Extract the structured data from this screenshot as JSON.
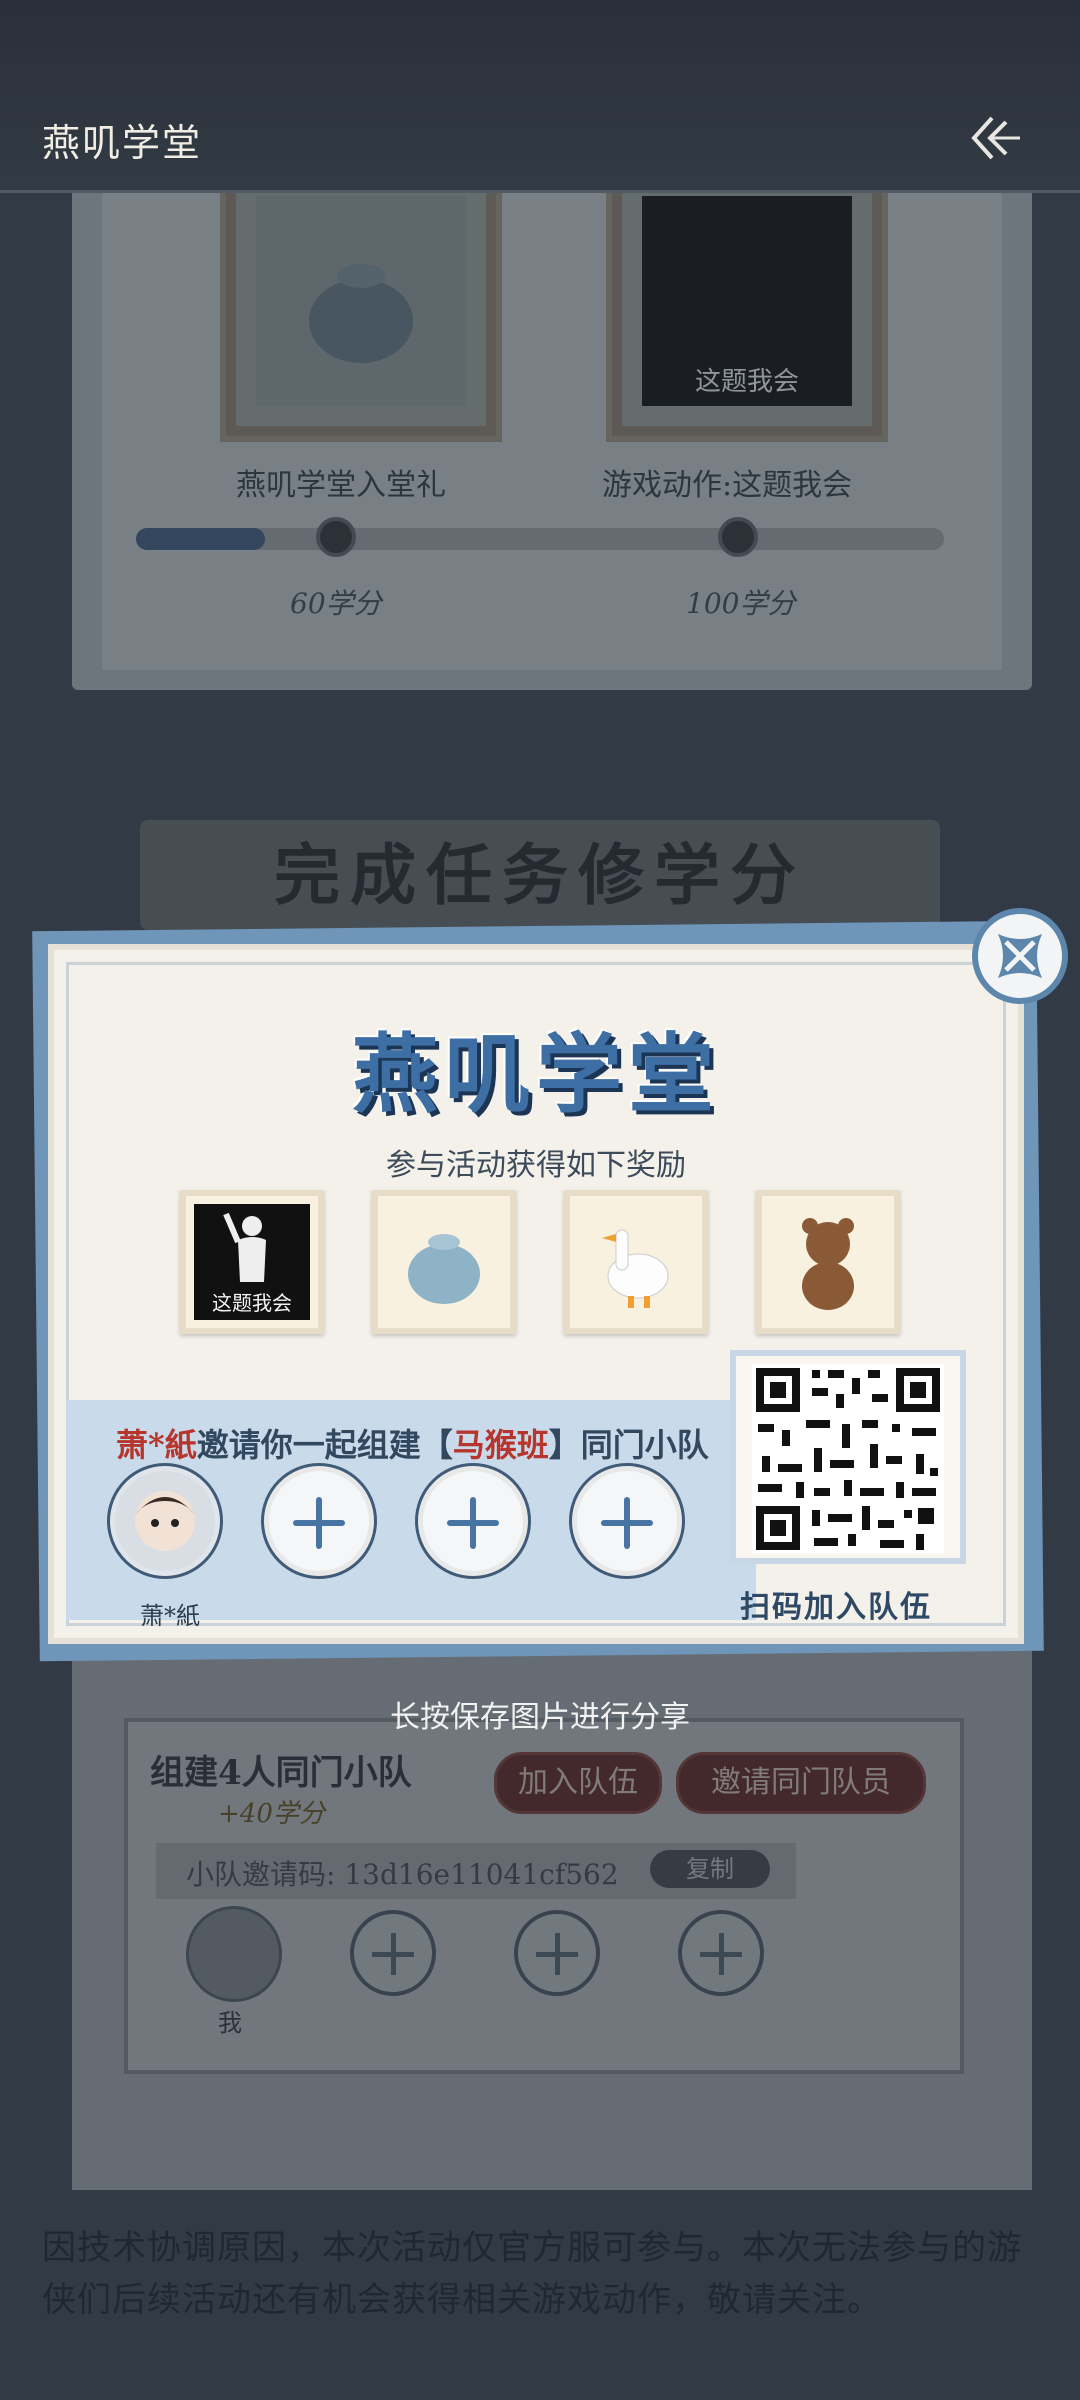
{
  "header": {
    "title": "燕叽学堂"
  },
  "rewards_track": {
    "items": [
      {
        "name": "燕叽学堂入堂礼"
      },
      {
        "name": "游戏动作:这题我会",
        "image_caption": "这题我会"
      }
    ],
    "milestones": [
      "60学分",
      "100学分"
    ],
    "progress_fraction": 0.16
  },
  "section": {
    "banner": "完成任务修学分"
  },
  "modal": {
    "logo": "燕叽学堂",
    "subtitle": "参与活动获得如下奖励",
    "items": [
      {
        "caption": "这题我会",
        "icon": "emote-pose-icon"
      },
      {
        "icon": "cloth-bag-icon"
      },
      {
        "icon": "white-goose-icon"
      },
      {
        "icon": "teddy-bear-icon"
      }
    ],
    "invite": {
      "inviter": "萧*紙",
      "text_before": "邀请你一起组建【",
      "team": "马猴班",
      "text_after": "】同门小队"
    },
    "member_name": "萧*紙",
    "qr_label": "扫码加入队伍",
    "save_hint": "长按保存图片进行分享"
  },
  "team": {
    "title": "组建4人同门小队",
    "bonus": "+40学分",
    "join_button": "加入队伍",
    "invite_button": "邀请同门队员",
    "code_label": "小队邀请码: 13d16e11041cf562",
    "copy_button": "复制",
    "self_label": "我"
  },
  "notice": "因技术协调原因，本次活动仅官方服可参与。本次无法参与的游侠们后续活动还有机会获得相关游戏动作，敬请关注。"
}
